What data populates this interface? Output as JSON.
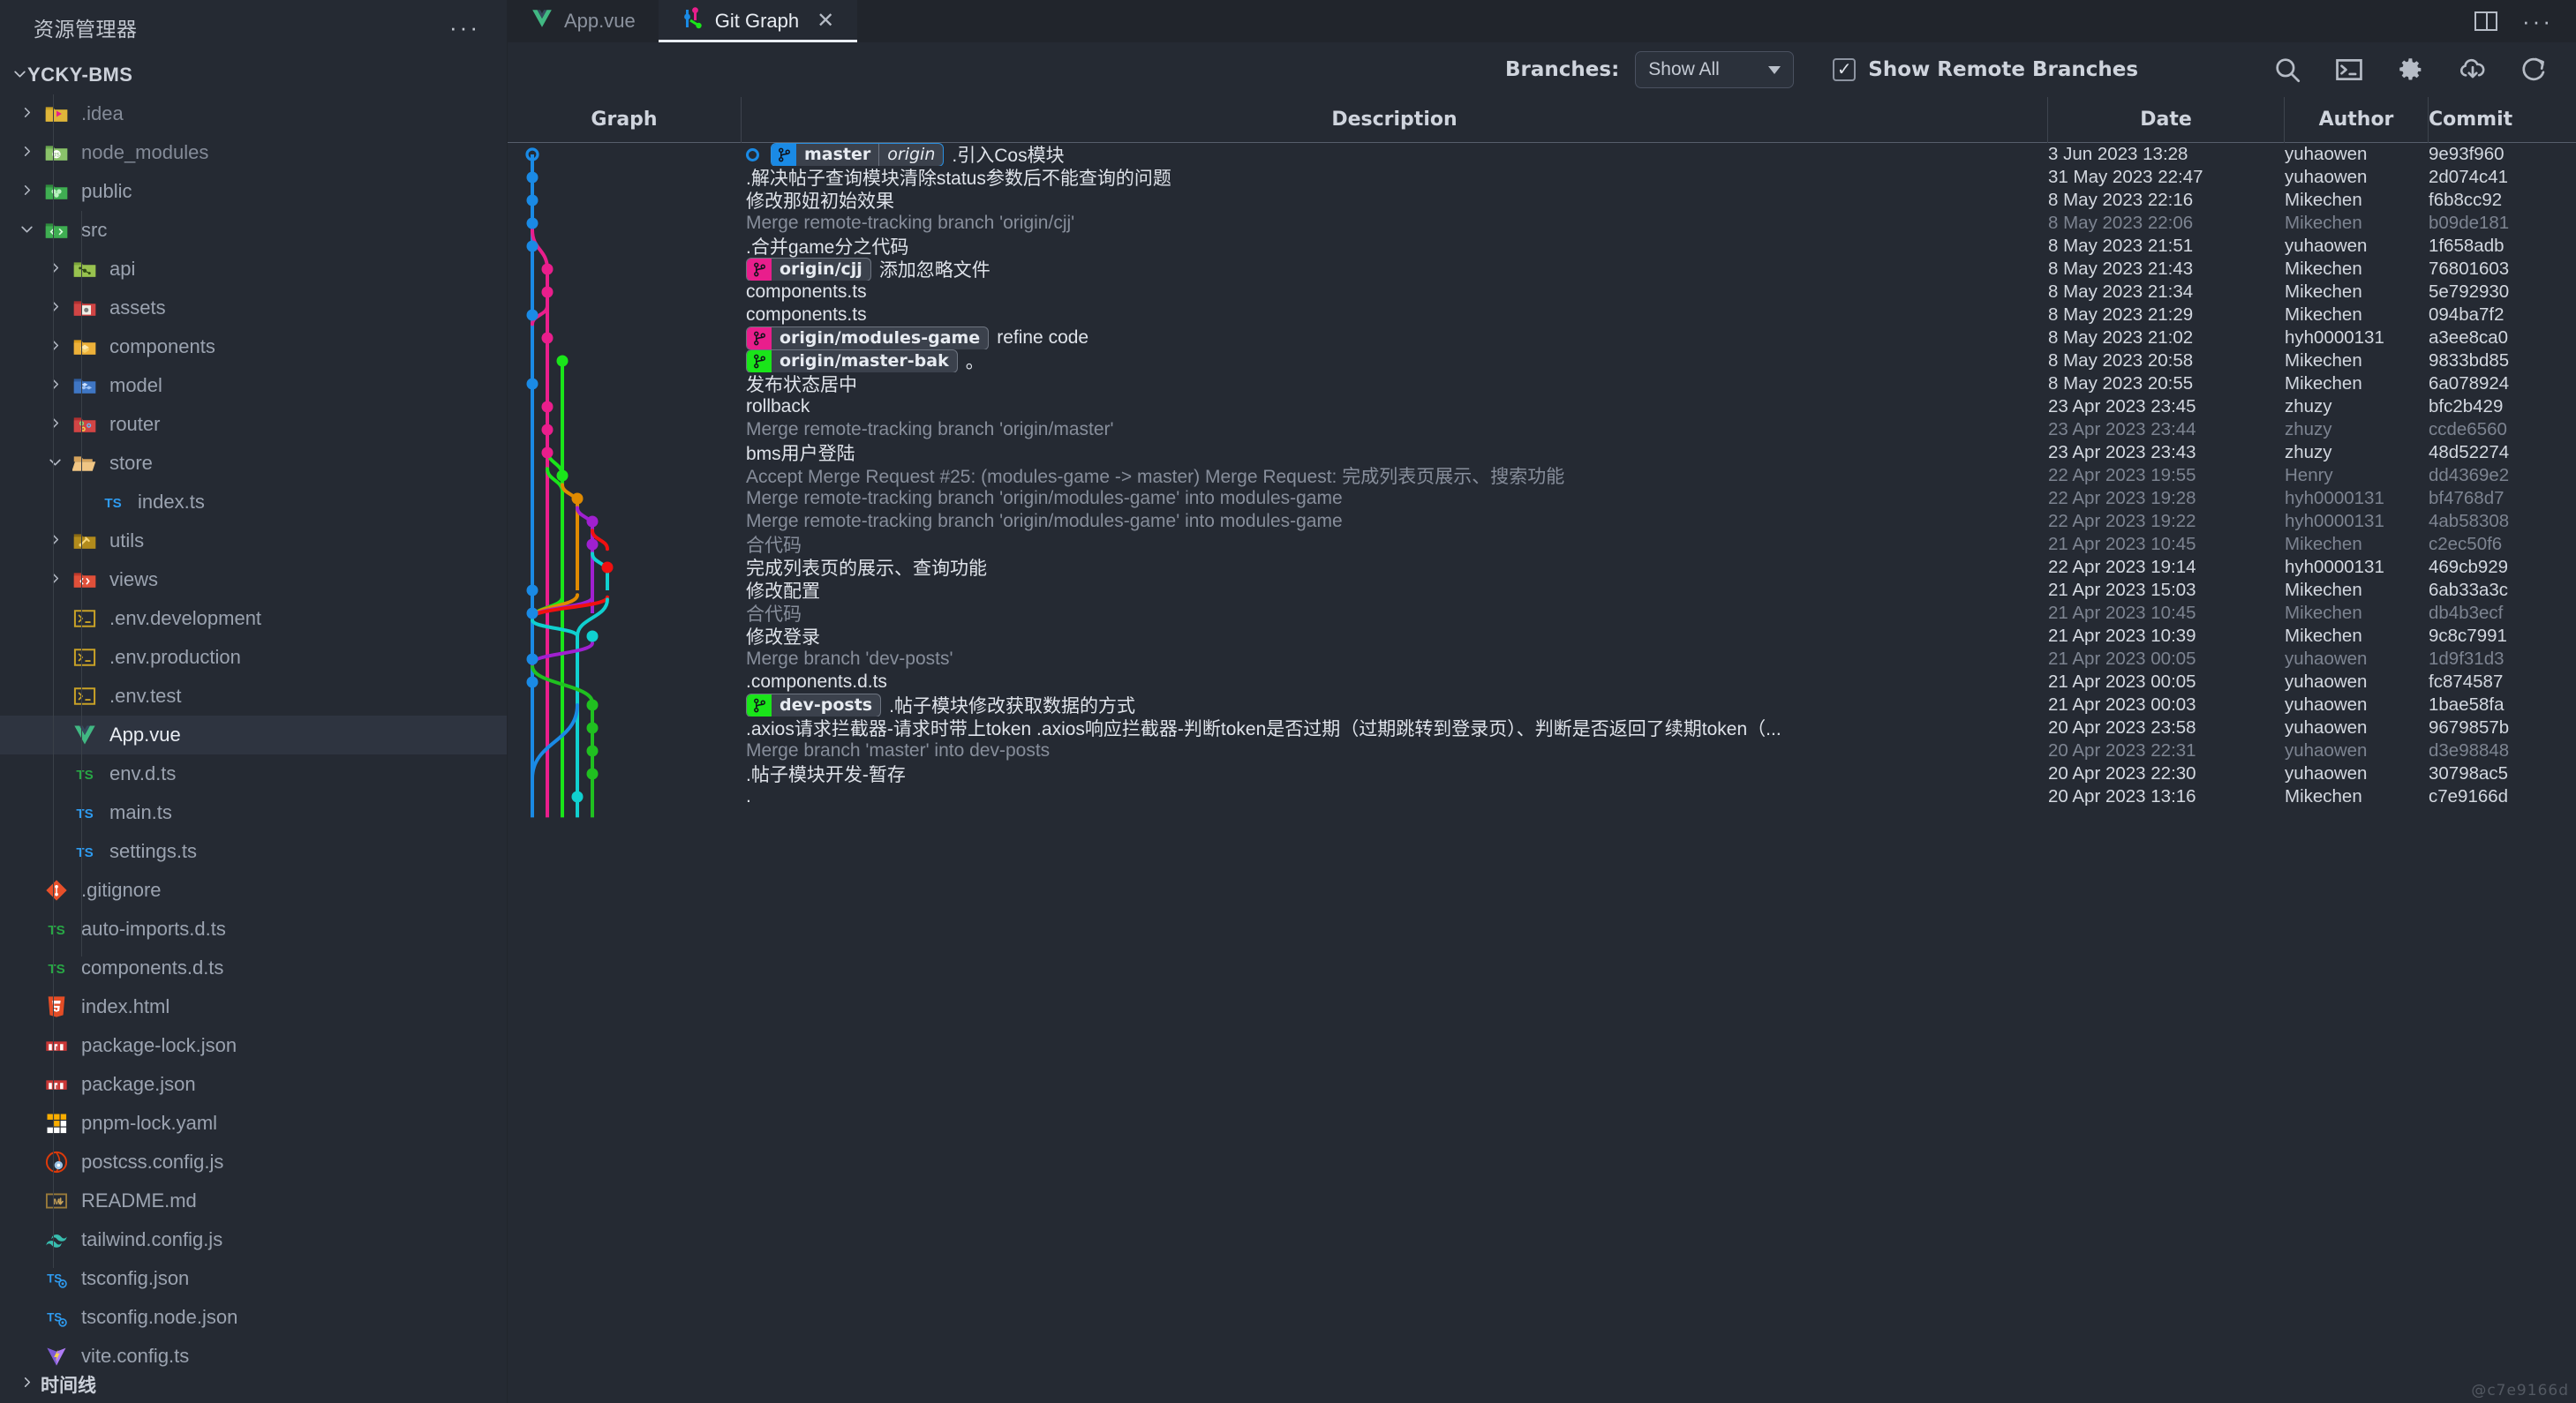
{
  "sidebar": {
    "title": "资源管理器",
    "more_label": "···",
    "root": {
      "label": "YCKY-BMS",
      "twisty": "chevron-down-icon"
    },
    "items": [
      {
        "label": ".idea",
        "icon": "folder-idea",
        "twisty": "chevron-right",
        "indent": 1,
        "dim": true
      },
      {
        "label": "node_modules",
        "icon": "folder-node",
        "twisty": "chevron-right",
        "indent": 1,
        "dim": true
      },
      {
        "label": "public",
        "icon": "folder-public",
        "twisty": "chevron-right",
        "indent": 1,
        "dim": false
      },
      {
        "label": "src",
        "icon": "folder-src",
        "twisty": "chevron-down",
        "indent": 1,
        "dim": false
      },
      {
        "label": "api",
        "icon": "folder-api",
        "twisty": "chevron-right",
        "indent": 2,
        "dim": false
      },
      {
        "label": "assets",
        "icon": "folder-assets",
        "twisty": "chevron-right",
        "indent": 2,
        "dim": false
      },
      {
        "label": "components",
        "icon": "folder-components",
        "twisty": "chevron-right",
        "indent": 2,
        "dim": false
      },
      {
        "label": "model",
        "icon": "folder-model",
        "twisty": "chevron-right",
        "indent": 2,
        "dim": false
      },
      {
        "label": "router",
        "icon": "folder-router",
        "twisty": "chevron-right",
        "indent": 2,
        "dim": false
      },
      {
        "label": "store",
        "icon": "folder-open",
        "twisty": "chevron-down",
        "indent": 2,
        "dim": false
      },
      {
        "label": "index.ts",
        "icon": "ts-blue",
        "twisty": "",
        "indent": 3,
        "dim": false
      },
      {
        "label": "utils",
        "icon": "folder-utils",
        "twisty": "chevron-right",
        "indent": 2,
        "dim": false
      },
      {
        "label": "views",
        "icon": "folder-views",
        "twisty": "chevron-right",
        "indent": 2,
        "dim": false
      },
      {
        "label": ".env.development",
        "icon": "env-file",
        "twisty": "",
        "indent": 2,
        "dim": false
      },
      {
        "label": ".env.production",
        "icon": "env-file",
        "twisty": "",
        "indent": 2,
        "dim": false
      },
      {
        "label": ".env.test",
        "icon": "env-file",
        "twisty": "",
        "indent": 2,
        "dim": false
      },
      {
        "label": "App.vue",
        "icon": "vue-file",
        "twisty": "",
        "indent": 2,
        "dim": false,
        "selected": true
      },
      {
        "label": "env.d.ts",
        "icon": "ts-green",
        "twisty": "",
        "indent": 2,
        "dim": false
      },
      {
        "label": "main.ts",
        "icon": "ts-blue",
        "twisty": "",
        "indent": 2,
        "dim": false
      },
      {
        "label": "settings.ts",
        "icon": "ts-blue",
        "twisty": "",
        "indent": 2,
        "dim": false
      },
      {
        "label": ".gitignore",
        "icon": "git-file",
        "twisty": "",
        "indent": 1,
        "dim": false
      },
      {
        "label": "auto-imports.d.ts",
        "icon": "ts-green",
        "twisty": "",
        "indent": 1,
        "dim": false
      },
      {
        "label": "components.d.ts",
        "icon": "ts-green",
        "twisty": "",
        "indent": 1,
        "dim": false
      },
      {
        "label": "index.html",
        "icon": "html-file",
        "twisty": "",
        "indent": 1,
        "dim": false
      },
      {
        "label": "package-lock.json",
        "icon": "npm-file",
        "twisty": "",
        "indent": 1,
        "dim": false
      },
      {
        "label": "package.json",
        "icon": "npm-file",
        "twisty": "",
        "indent": 1,
        "dim": false
      },
      {
        "label": "pnpm-lock.yaml",
        "icon": "pnpm-file",
        "twisty": "",
        "indent": 1,
        "dim": false
      },
      {
        "label": "postcss.config.js",
        "icon": "postcss-file",
        "twisty": "",
        "indent": 1,
        "dim": false
      },
      {
        "label": "README.md",
        "icon": "md-file",
        "twisty": "",
        "indent": 1,
        "dim": false
      },
      {
        "label": "tailwind.config.js",
        "icon": "tailwind-file",
        "twisty": "",
        "indent": 1,
        "dim": false
      },
      {
        "label": "tsconfig.json",
        "icon": "tsconfig-file",
        "twisty": "",
        "indent": 1,
        "dim": false
      },
      {
        "label": "tsconfig.node.json",
        "icon": "tsconfig-file",
        "twisty": "",
        "indent": 1,
        "dim": false
      },
      {
        "label": "vite.config.ts",
        "icon": "vite-file",
        "twisty": "",
        "indent": 1,
        "dim": false
      }
    ],
    "timeline": {
      "label": "时间线",
      "twisty": "chevron-right"
    }
  },
  "tabs": [
    {
      "label": "App.vue",
      "icon": "vue-icon",
      "active": false,
      "closable": false
    },
    {
      "label": "Git Graph",
      "icon": "git-graph-icon",
      "active": true,
      "closable": true,
      "close_label": "✕"
    }
  ],
  "editor_actions": {
    "split_label": "split-editor",
    "more_label": "···"
  },
  "toolbar": {
    "branches_label": "Branches:",
    "branch_select_value": "Show All",
    "show_remote_label": "Show Remote Branches",
    "show_remote_checked": true,
    "check_glyph": "✓",
    "icons": [
      "search-icon",
      "terminal-icon",
      "gear-icon",
      "cloud-download-icon",
      "refresh-icon"
    ]
  },
  "table": {
    "headers": {
      "graph": "Graph",
      "description": "Description",
      "date": "Date",
      "author": "Author",
      "commit": "Commit"
    },
    "rows": [
      {
        "refs": [
          {
            "name": "master",
            "type": "local",
            "color": "#1a8ae5"
          },
          {
            "name": "origin",
            "type": "remote-italic",
            "color": "#1a8ae5"
          }
        ],
        "head": true,
        "desc": ".引入Cos模块",
        "date": "3 Jun 2023 13:28",
        "author": "yuhaowen",
        "commit": "9e93f960",
        "muted": false
      },
      {
        "refs": [],
        "desc": ".解决帖子查询模块清除status参数后不能查询的问题",
        "date": "31 May 2023 22:47",
        "author": "yuhaowen",
        "commit": "2d074c41",
        "muted": false
      },
      {
        "refs": [],
        "desc": "修改那妞初始效果",
        "date": "8 May 2023 22:16",
        "author": "Mikechen",
        "commit": "f6b8cc92",
        "muted": false
      },
      {
        "refs": [],
        "desc": "Merge remote-tracking branch 'origin/cjj'",
        "date": "8 May 2023 22:06",
        "author": "Mikechen",
        "commit": "b09de181",
        "muted": true
      },
      {
        "refs": [],
        "desc": ".合并game分之代码",
        "date": "8 May 2023 21:51",
        "author": "yuhaowen",
        "commit": "1f658adb",
        "muted": false
      },
      {
        "refs": [
          {
            "name": "origin/cjj",
            "type": "remote",
            "color": "#e91e8c"
          }
        ],
        "desc": "添加忽略文件",
        "date": "8 May 2023 21:43",
        "author": "Mikechen",
        "commit": "76801603",
        "muted": false
      },
      {
        "refs": [],
        "desc": "components.ts",
        "date": "8 May 2023 21:34",
        "author": "Mikechen",
        "commit": "5e792930",
        "muted": false
      },
      {
        "refs": [],
        "desc": "components.ts",
        "date": "8 May 2023 21:29",
        "author": "Mikechen",
        "commit": "094ba7f2",
        "muted": false
      },
      {
        "refs": [
          {
            "name": "origin/modules-game",
            "type": "remote",
            "color": "#e91e8c"
          }
        ],
        "desc": "refine code",
        "date": "8 May 2023 21:02",
        "author": "hyh0000131",
        "commit": "a3ee8ca0",
        "muted": false
      },
      {
        "refs": [
          {
            "name": "origin/master-bak",
            "type": "remote",
            "color": "#1ae51a"
          }
        ],
        "desc": "。",
        "date": "8 May 2023 20:58",
        "author": "Mikechen",
        "commit": "9833bd85",
        "muted": false
      },
      {
        "refs": [],
        "desc": "发布状态居中",
        "date": "8 May 2023 20:55",
        "author": "Mikechen",
        "commit": "6a078924",
        "muted": false
      },
      {
        "refs": [],
        "desc": "rollback",
        "date": "23 Apr 2023 23:45",
        "author": "zhuzy",
        "commit": "bfc2b429",
        "muted": false
      },
      {
        "refs": [],
        "desc": "Merge remote-tracking branch 'origin/master'",
        "date": "23 Apr 2023 23:44",
        "author": "zhuzy",
        "commit": "ccde6560",
        "muted": true
      },
      {
        "refs": [],
        "desc": "bms用户登陆",
        "date": "23 Apr 2023 23:43",
        "author": "zhuzy",
        "commit": "48d52274",
        "muted": false
      },
      {
        "refs": [],
        "desc": "Accept Merge Request #25: (modules-game -> master) Merge Request: 完成列表页展示、搜索功能",
        "date": "22 Apr 2023 19:55",
        "author": "Henry",
        "commit": "dd4369e2",
        "muted": true
      },
      {
        "refs": [],
        "desc": "Merge remote-tracking branch 'origin/modules-game' into modules-game",
        "date": "22 Apr 2023 19:28",
        "author": "hyh0000131",
        "commit": "bf4768d7",
        "muted": true
      },
      {
        "refs": [],
        "desc": "Merge remote-tracking branch 'origin/modules-game' into modules-game",
        "date": "22 Apr 2023 19:22",
        "author": "hyh0000131",
        "commit": "4ab58308",
        "muted": true
      },
      {
        "refs": [],
        "desc": "合代码",
        "date": "21 Apr 2023 10:45",
        "author": "Mikechen",
        "commit": "c2ec50f6",
        "muted": true
      },
      {
        "refs": [],
        "desc": "完成列表页的展示、查询功能",
        "date": "22 Apr 2023 19:14",
        "author": "hyh0000131",
        "commit": "469cb929",
        "muted": false
      },
      {
        "refs": [],
        "desc": "修改配置",
        "date": "21 Apr 2023 15:03",
        "author": "Mikechen",
        "commit": "6ab33a3c",
        "muted": false
      },
      {
        "refs": [],
        "desc": "合代码",
        "date": "21 Apr 2023 10:45",
        "author": "Mikechen",
        "commit": "db4b3ecf",
        "muted": true
      },
      {
        "refs": [],
        "desc": "修改登录",
        "date": "21 Apr 2023 10:39",
        "author": "Mikechen",
        "commit": "9c8c7991",
        "muted": false
      },
      {
        "refs": [],
        "desc": "Merge branch 'dev-posts'",
        "date": "21 Apr 2023 00:05",
        "author": "yuhaowen",
        "commit": "1d9f31d3",
        "muted": true
      },
      {
        "refs": [],
        "desc": ".components.d.ts",
        "date": "21 Apr 2023 00:05",
        "author": "yuhaowen",
        "commit": "fc874587",
        "muted": false
      },
      {
        "refs": [
          {
            "name": "dev-posts",
            "type": "local",
            "color": "#1ae51a"
          }
        ],
        "desc": ".帖子模块修改获取数据的方式",
        "date": "21 Apr 2023 00:03",
        "author": "yuhaowen",
        "commit": "1bae58fa",
        "muted": false
      },
      {
        "refs": [],
        "desc": ".axios请求拦截器-请求时带上token .axios响应拦截器-判断token是否过期（过期跳转到登录页）、判断是否返回了续期token（...",
        "date": "20 Apr 2023 23:58",
        "author": "yuhaowen",
        "commit": "9679857b",
        "muted": false
      },
      {
        "refs": [],
        "desc": "Merge branch 'master' into dev-posts",
        "date": "20 Apr 2023 22:31",
        "author": "yuhaowen",
        "commit": "d3e98848",
        "muted": true
      },
      {
        "refs": [],
        "desc": ".帖子模块开发-暂存",
        "date": "20 Apr 2023 22:30",
        "author": "yuhaowen",
        "commit": "30798ac5",
        "muted": false
      },
      {
        "refs": [],
        "desc": ".",
        "date": "20 Apr 2023 13:16",
        "author": "Mikechen",
        "commit": "c7e9166d",
        "muted": false
      }
    ]
  },
  "watermark": "@c7e9166d"
}
